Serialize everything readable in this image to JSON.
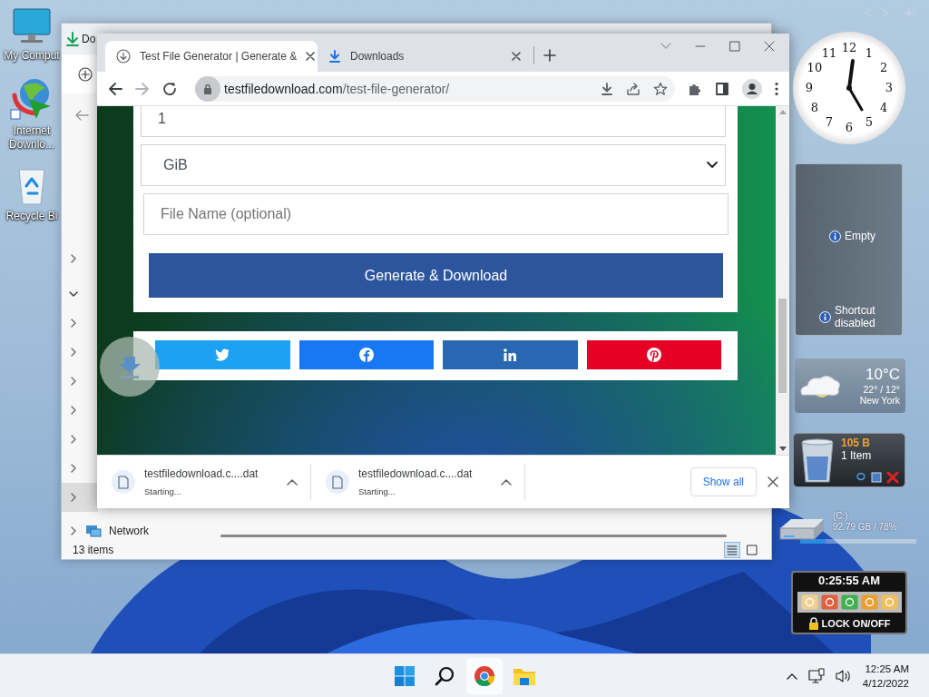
{
  "desktop_icons": [
    {
      "kind": "computer",
      "label": "My Comput"
    },
    {
      "kind": "downloader",
      "label": "Internet Downlo..."
    },
    {
      "kind": "recycle_bin",
      "label": "Recycle Bi"
    }
  ],
  "explorer": {
    "title": "Do",
    "nav_items": [
      {
        "expanded": false,
        "selected": false
      },
      {
        "expanded": true,
        "selected": false
      },
      {
        "expanded": false,
        "selected": false
      },
      {
        "expanded": false,
        "selected": false
      },
      {
        "expanded": false,
        "selected": false
      },
      {
        "expanded": false,
        "selected": false
      },
      {
        "expanded": false,
        "selected": false
      },
      {
        "expanded": false,
        "selected": false
      },
      {
        "expanded": false,
        "selected": true
      },
      {
        "label": "Network",
        "expanded": false,
        "selected": false
      }
    ],
    "status": "13 items",
    "views": [
      {
        "kind": "details",
        "selected": true
      },
      {
        "kind": "tiles",
        "selected": false
      }
    ]
  },
  "browser": {
    "tabs": [
      {
        "kind": "page",
        "title": "Test File Generator | Generate &",
        "selected": true
      },
      {
        "kind": "downloads",
        "title": "Downloads",
        "selected": false
      }
    ],
    "address": {
      "host": "testfiledownload.com",
      "path": "/test-file-generator/"
    },
    "form": {
      "size": {
        "value": "1"
      },
      "unit": {
        "value": "GiB"
      },
      "file_name": {
        "placeholder": "File Name (optional)"
      },
      "submit": "Generate & Download"
    },
    "share_buttons": [
      {
        "kind": "twitter",
        "color": "#1da1f2"
      },
      {
        "kind": "facebook",
        "color": "#1877f2"
      },
      {
        "kind": "linkedin",
        "color": "#2867b2"
      },
      {
        "kind": "pinterest",
        "color": "#e60023"
      }
    ],
    "downloads": [
      {
        "file": "testfiledownload.c....dat",
        "status": "Starting..."
      },
      {
        "file": "testfiledownload.c....dat",
        "status": "Starting..."
      }
    ],
    "show_all": "Show all"
  },
  "gadgets": {
    "clock_numerals": [
      "11",
      "12",
      "1",
      "10",
      "2",
      "9",
      "3",
      "8",
      "4",
      "7",
      "5",
      "6"
    ],
    "slideshow": {
      "message": "Empty",
      "note": "Shortcut disabled"
    },
    "weather": {
      "temperature": "10°C",
      "range": "22° / 12°",
      "city": "New York"
    },
    "recycle_bin": {
      "size": "105 B",
      "count": "1 Item"
    },
    "drive": {
      "name": "(C:)",
      "usage": "92.79 GB / 78%",
      "level": 0.22
    },
    "lock": {
      "time": "0:25:55 AM",
      "label": "LOCK ON/OFF"
    }
  },
  "taskbar": {
    "apps": [
      {
        "kind": "start",
        "selected": false
      },
      {
        "kind": "search",
        "selected": false
      },
      {
        "kind": "chrome",
        "selected": true
      },
      {
        "kind": "explorer",
        "selected": false
      }
    ],
    "time": "12:25 AM",
    "date": "4/12/2022"
  }
}
